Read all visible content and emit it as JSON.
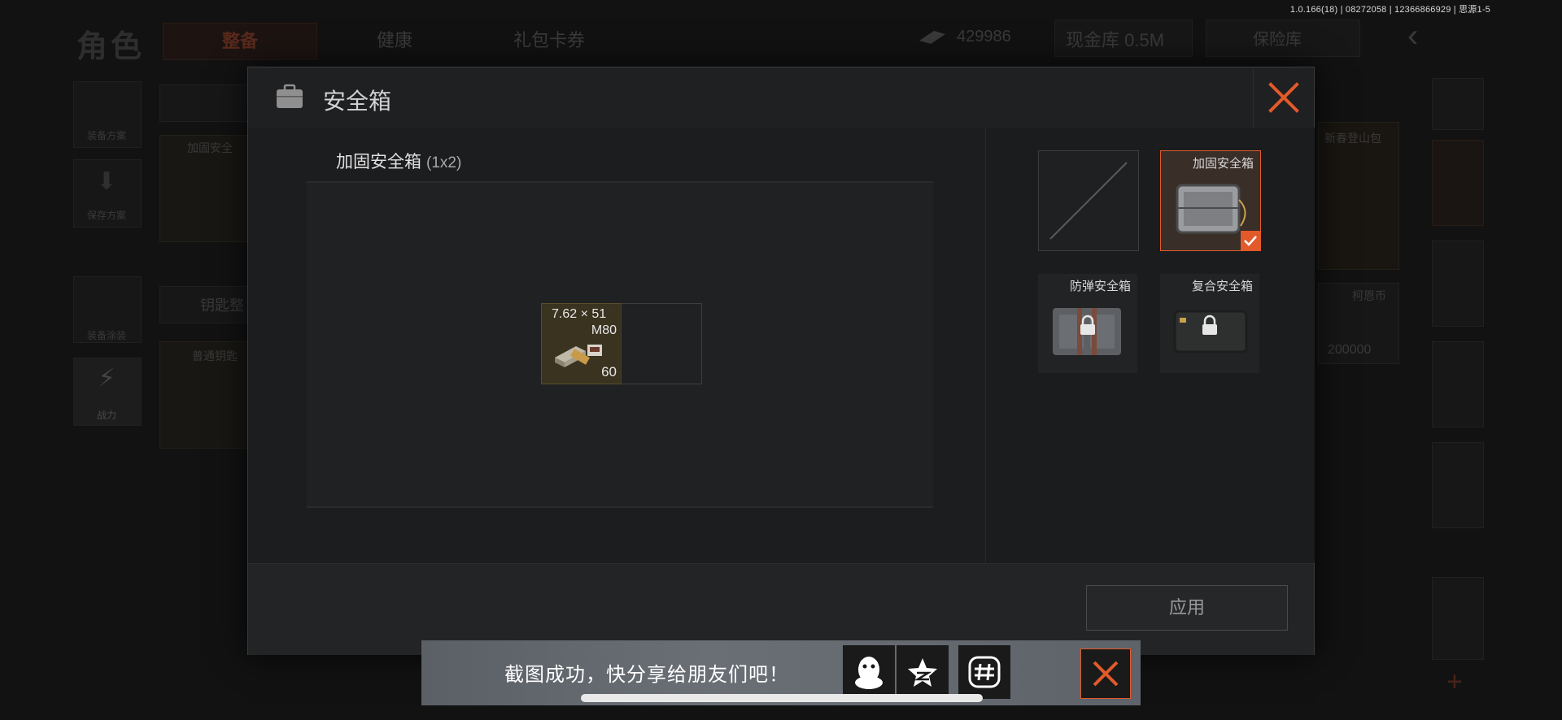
{
  "status_bar": {
    "version": "1.0.166(18) | 08272058 | 12366866929 | 思源1-5"
  },
  "background": {
    "title": "角色",
    "tabs": [
      "整备",
      "健康",
      "礼包卡券"
    ],
    "currency": "429986",
    "cash_vault": "现金库 0.5M",
    "safe_vault": "保险库",
    "side_menu": [
      "装备方案",
      "保存方案",
      "装备涂装",
      "战力"
    ],
    "left_item_label": "加固安全",
    "key_tab": "钥匙整",
    "key_item": "普通钥匙",
    "backpack_label": "新春登山包",
    "coin_label": "柯恩币",
    "coin_amount": "200000"
  },
  "modal": {
    "title": "安全箱",
    "container_name": "加固安全箱",
    "container_size": "(1x2)",
    "item": {
      "name": "7.62 × 51",
      "type": "M80",
      "count": "60"
    },
    "cases": [
      {
        "label": "",
        "state": "empty"
      },
      {
        "label": "加固安全箱",
        "state": "selected"
      },
      {
        "label": "防弹安全箱",
        "state": "locked"
      },
      {
        "label": "复合安全箱",
        "state": "locked"
      }
    ],
    "apply_label": "应用",
    "accent": "#e25a2a"
  },
  "toast": {
    "message": "截图成功，快分享给朋友们吧！"
  }
}
